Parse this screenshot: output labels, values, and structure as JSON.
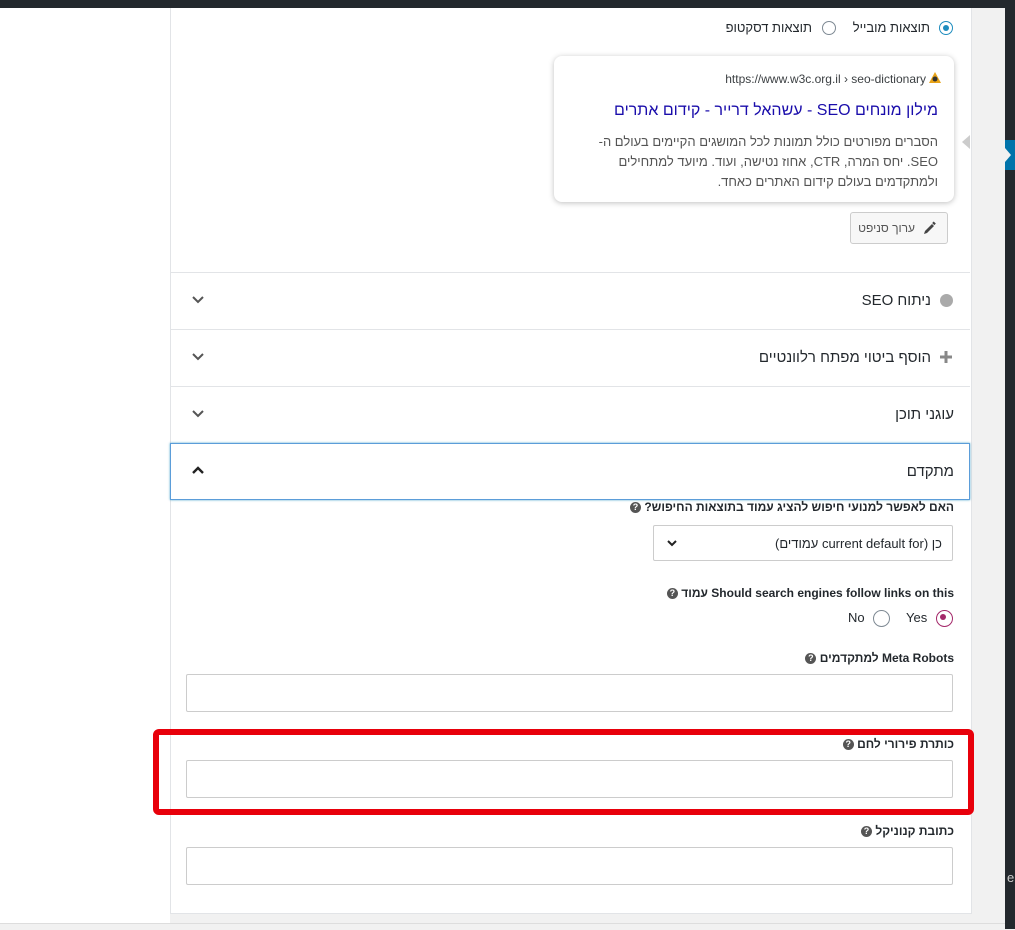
{
  "preview_mode": {
    "mobile_label": "תוצאות מובייל",
    "desktop_label": "תוצאות דסקטופ",
    "selected": "mobile"
  },
  "snippet": {
    "url": "https://www.w3c.org.il › seo-dictionary",
    "title": "מילון מונחים SEO - עשהאל דרייר - קידום אתרים",
    "description": "הסברים מפורטים כולל תמונות לכל המושגים הקיימים בעולם ה-SEO. יחס המרה, CTR, אחוז נטישה, ועוד. מיועד למתחילים ולמתקדמים בעולם קידום האתרים כאחד.",
    "edit_button": "ערוך סניפט"
  },
  "sections": {
    "seo_analysis": "ניתוח SEO",
    "add_keyphrase": "הוסף ביטוי מפתח רלוונטיים",
    "cornerstone": "עוגני תוכן",
    "advanced": "מתקדם"
  },
  "advanced": {
    "allow_search_q": "האם לאפשר למנועי חיפוש להציג עמוד בתוצאות החיפוש?",
    "allow_search_value": "כן (current default for עמודים)",
    "follow_q": "Should search engines follow links on this עמוד",
    "follow_yes": "Yes",
    "follow_no": "No",
    "follow_selected": "yes",
    "meta_robots_label": "Meta Robots למתקדמים",
    "meta_robots_value": "",
    "breadcrumbs_label": "כותרת פירורי לחם",
    "breadcrumbs_value": "",
    "canonical_label": "כתובת קנוניקל",
    "canonical_value": ""
  },
  "colors": {
    "highlight": "#e8000b",
    "link": "#1a0dab",
    "accent": "#1e8cbe",
    "radio_selected": "#a4286a"
  },
  "side_tab_text": "e"
}
